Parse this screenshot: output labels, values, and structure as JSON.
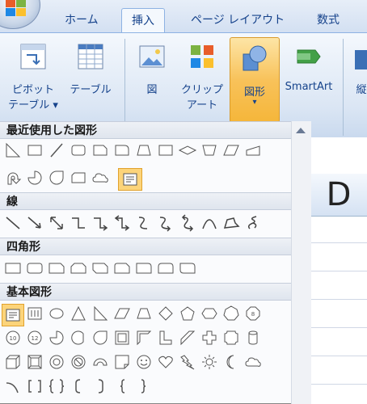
{
  "ribbon": {
    "tabs": [
      "ホーム",
      "挿入",
      "ページ レイアウト",
      "数式"
    ],
    "active_tab": "挿入",
    "buttons": {
      "pivot_line1": "ピボット",
      "pivot_line2": "テーブル ▾",
      "table": "テーブル",
      "picture": "図",
      "clip_line1": "クリップ",
      "clip_line2": "アート",
      "shapes": "図形",
      "shapes_arrow": "▾",
      "smartart": "SmartArt",
      "next_clip": "縦"
    }
  },
  "sheet": {
    "column_header": "D"
  },
  "shapes_menu": {
    "sections": {
      "recent": "最近使用した図形",
      "lines": "線",
      "rectangles": "四角形",
      "basic": "基本図形"
    },
    "selected_recent": "text-box-icon",
    "selected_basic": "text-box-icon"
  },
  "colors": {
    "accent": "#f5b63a",
    "ribbon_text": "#15428b",
    "panel_bg": "#fafbfd"
  }
}
